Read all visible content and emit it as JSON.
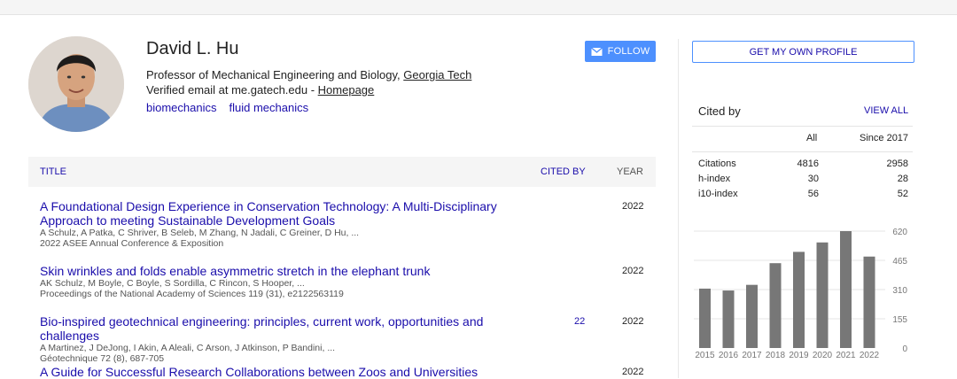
{
  "profile": {
    "name": "David L. Hu",
    "position": "Professor of Mechanical Engineering and Biology, ",
    "affiliation": "Georgia Tech",
    "email": "Verified email at me.gatech.edu - ",
    "homepage": "Homepage",
    "interests": [
      "biomechanics",
      "fluid mechanics"
    ]
  },
  "buttons": {
    "follow": "FOLLOW",
    "get_profile": "GET MY OWN PROFILE"
  },
  "table": {
    "headers": {
      "title": "TITLE",
      "cited_by": "CITED BY",
      "year": "YEAR"
    },
    "articles": [
      {
        "title": "A Foundational Design Experience in Conservation Technology: A Multi-Disciplinary Approach to meeting Sustainable Development Goals",
        "authors": "A Schulz, A Patka, C Shriver, B Seleb, M Zhang, N Jadali, C Greiner, D Hu, ...",
        "venue": "2022 ASEE Annual Conference & Exposition",
        "cited_by": "",
        "year": "2022"
      },
      {
        "title": "Skin wrinkles and folds enable asymmetric stretch in the elephant trunk",
        "authors": "AK Schulz, M Boyle, C Boyle, S Sordilla, C Rincon, S Hooper, ...",
        "venue": "Proceedings of the National Academy of Sciences 119 (31), e2122563119",
        "cited_by": "",
        "year": "2022"
      },
      {
        "title": "Bio-inspired geotechnical engineering: principles, current work, opportunities and challenges",
        "authors": "A Martinez, J DeJong, I Akin, A Aleali, C Arson, J Atkinson, P Bandini, ...",
        "venue": "Géotechnique 72 (8), 687-705",
        "cited_by": "22",
        "year": "2022"
      },
      {
        "title": "A Guide for Successful Research Collaborations between Zoos and Universities",
        "authors": "",
        "venue": "",
        "cited_by": "",
        "year": "2022"
      }
    ]
  },
  "cited_by": {
    "title": "Cited by",
    "view_all": "VIEW ALL",
    "columns": {
      "all": "All",
      "since": "Since 2017"
    },
    "metrics": [
      {
        "name": "Citations",
        "all": "4816",
        "since": "2958"
      },
      {
        "name": "h-index",
        "all": "30",
        "since": "28"
      },
      {
        "name": "i10-index",
        "all": "56",
        "since": "52"
      }
    ]
  },
  "chart_data": {
    "type": "bar",
    "categories": [
      "2015",
      "2016",
      "2017",
      "2018",
      "2019",
      "2020",
      "2021",
      "2022"
    ],
    "values": [
      315,
      305,
      335,
      450,
      510,
      560,
      620,
      485
    ],
    "yticks": [
      0,
      155,
      310,
      465,
      620
    ],
    "ylim": [
      0,
      620
    ],
    "bar_color": "#777777"
  },
  "colors": {
    "link": "#1a0dab",
    "accent": "#4d90fe"
  }
}
